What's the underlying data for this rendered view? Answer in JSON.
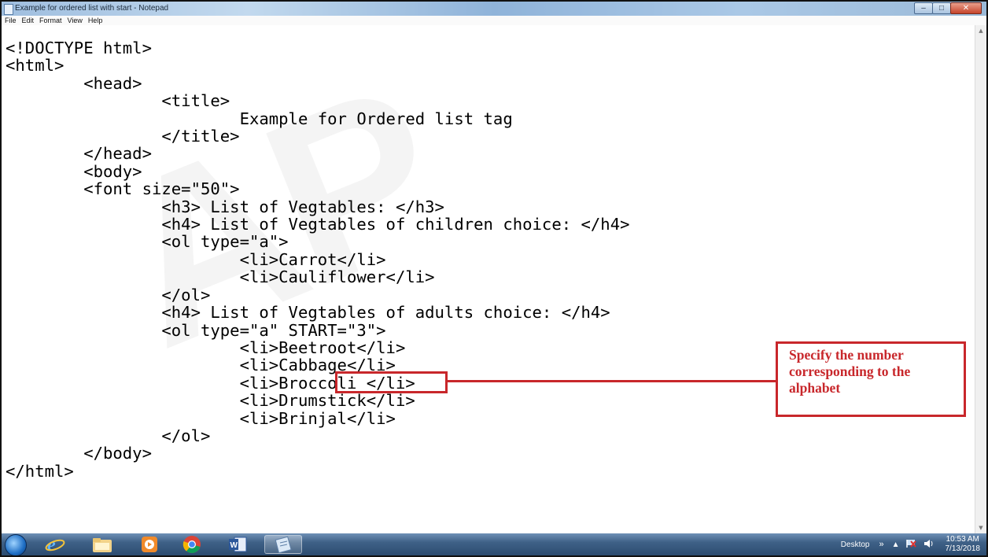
{
  "window": {
    "title": "Example for ordered list with start - Notepad",
    "controls": {
      "minimize": "–",
      "maximize": "□",
      "close": "✕"
    }
  },
  "menu": [
    "File",
    "Edit",
    "Format",
    "View",
    "Help"
  ],
  "editor": {
    "lines": [
      "<!DOCTYPE html>",
      "<html>",
      "        <head>",
      "                <title>",
      "                        Example for Ordered list tag",
      "                </title>",
      "        </head>",
      "        <body>",
      "        <font size=\"50\">",
      "                <h3> List of Vegtables: </h3>",
      "                <h4> List of Vegtables of children choice: </h4>",
      "                <ol type=\"a\">",
      "                        <li>Carrot</li>",
      "                        <li>Cauliflower</li>",
      "                </ol>",
      "                <h4> List of Vegtables of adults choice: </h4>",
      "                <ol type=\"a\" START=\"3\">",
      "                        <li>Beetroot</li>",
      "                        <li>Cabbage</li>",
      "                        <li>Broccoli </li>",
      "                        <li>Drumstick</li>",
      "                        <li>Brinjal</li>",
      "                </ol>",
      "        </body>",
      "</html>"
    ]
  },
  "annotation": {
    "highlighted_text": "START=\"3\"",
    "callout_text": "Specify the number corresponding to the alphabet",
    "color": "#c8272b"
  },
  "watermark": {
    "text": "AP"
  },
  "taskbar": {
    "icons": [
      "windows-start-icon",
      "internet-explorer-icon",
      "file-explorer-icon",
      "media-player-icon",
      "chrome-icon",
      "word-icon",
      "notepad-icon"
    ],
    "tray": {
      "desktop_label": "Desktop",
      "chevron": "»",
      "time": "10:53 AM",
      "date": "7/13/2018"
    }
  }
}
